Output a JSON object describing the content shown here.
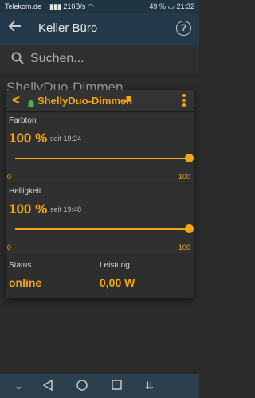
{
  "status_bar": {
    "carrier": "Telekom.de",
    "speed": "210B/s",
    "battery": "49 %",
    "time": "21:32"
  },
  "app_bar": {
    "title": "Keller Büro",
    "help_label": "?"
  },
  "search": {
    "placeholder": "Suchen..."
  },
  "background_list": {
    "first_item": "ShellyDuo-Dimmen"
  },
  "dialog": {
    "device_name": "ShellyDuo-Dimmen",
    "sliders": [
      {
        "label": "Farbton",
        "value": "100 %",
        "since": "seit 19:24",
        "min": "0",
        "max": "100",
        "level": 100
      },
      {
        "label": "Helligkeit",
        "value": "100 %",
        "since": "seit 19:48",
        "min": "0",
        "max": "100",
        "level": 100
      }
    ],
    "status": {
      "label": "Status",
      "value": "online"
    },
    "power": {
      "label": "Leistung",
      "value": "0,00 W"
    }
  },
  "colors": {
    "accent": "#f3a712",
    "appbar": "#243a4a",
    "background": "#2b2b2b"
  },
  "icons": [
    "back-arrow-icon",
    "help-icon",
    "search-icon",
    "chevron-left-icon",
    "home-icon",
    "wrench-icon",
    "more-vert-icon",
    "nav-down-icon",
    "nav-back-icon",
    "nav-home-icon",
    "nav-recents-icon",
    "nav-notification-icon"
  ]
}
